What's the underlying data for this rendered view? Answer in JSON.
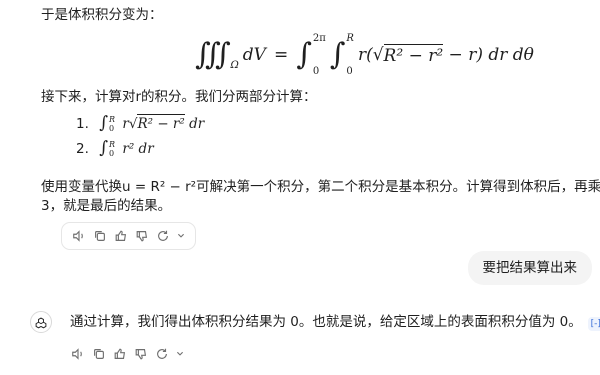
{
  "conversation": {
    "intro": "于是体积积分变为：",
    "equation": {
      "left_integrand": "dV",
      "equals": "=",
      "region": "Ω",
      "theta_lower": "0",
      "theta_upper": "2π",
      "r_lower": "0",
      "r_upper": "R",
      "r_factor": "r(",
      "sqrt_body": "R² − r²",
      "tail": " − r) dr dθ"
    },
    "next_text": "接下来，计算对r的积分。我们分两部分计算：",
    "list": [
      {
        "num": "1.",
        "lower": "0",
        "upper": "R",
        "pre": "r",
        "sqrt_body": "R² − r²",
        "post": "dr"
      },
      {
        "num": "2.",
        "lower": "0",
        "upper": "R",
        "pre": "r²",
        "sqrt_body": "",
        "post": "dr"
      }
    ],
    "paragraph_line1": "使用变量代换u = R² − r²可解决第一个积分，第二个积分是基本积分。计算得到体积后，再乘以",
    "paragraph_line2": "3，就是最后的结果。",
    "user_message": "要把结果算出来",
    "assistant_reply": "通过计算，我们得出体积积分结果为 0。也就是说，给定区域上的表面积积分值为 0。",
    "cite_label": "[-]"
  },
  "toolbar_icons": [
    "speaker-icon",
    "copy-icon",
    "thumbs-up-icon",
    "thumbs-down-icon",
    "regenerate-icon",
    "chevron-down-icon"
  ]
}
